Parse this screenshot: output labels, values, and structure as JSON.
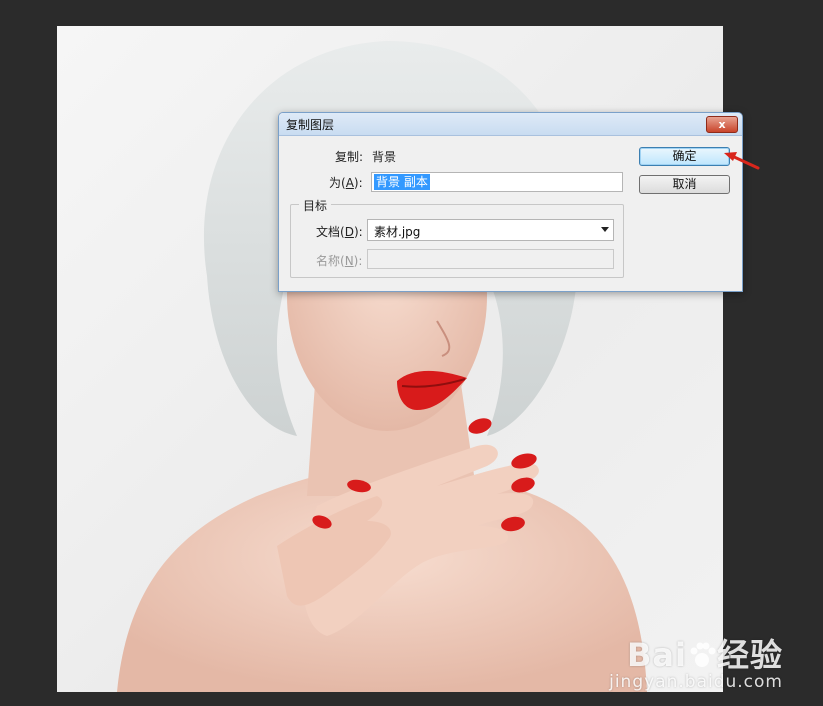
{
  "dialog": {
    "title": "复制图层",
    "copy_label": "复制:",
    "copy_value": "背景",
    "as_label_prefix": "为(",
    "as_label_key": "A",
    "as_label_suffix": "):",
    "as_value": "背景 副本",
    "group_legend": "目标",
    "document_label_prefix": "文档(",
    "document_label_key": "D",
    "document_label_suffix": "):",
    "document_value": "素材.jpg",
    "name_label_prefix": "名称(",
    "name_label_key": "N",
    "name_label_suffix": "):",
    "name_value": "",
    "ok_label": "确定",
    "cancel_label": "取消",
    "close_glyph": "x"
  },
  "watermark": {
    "logo_left": "Bai",
    "logo_right": "经验",
    "url": "jingyan.baidu.com"
  },
  "colors": {
    "background": "#2b2b2b",
    "selection": "#3399ff",
    "arrow": "#d9261c",
    "lips": "#d81b1b"
  },
  "icons": {
    "close": "close-icon",
    "dropdown": "chevron-down-icon",
    "pointer": "red-arrow-icon",
    "logo": "paw-icon"
  }
}
